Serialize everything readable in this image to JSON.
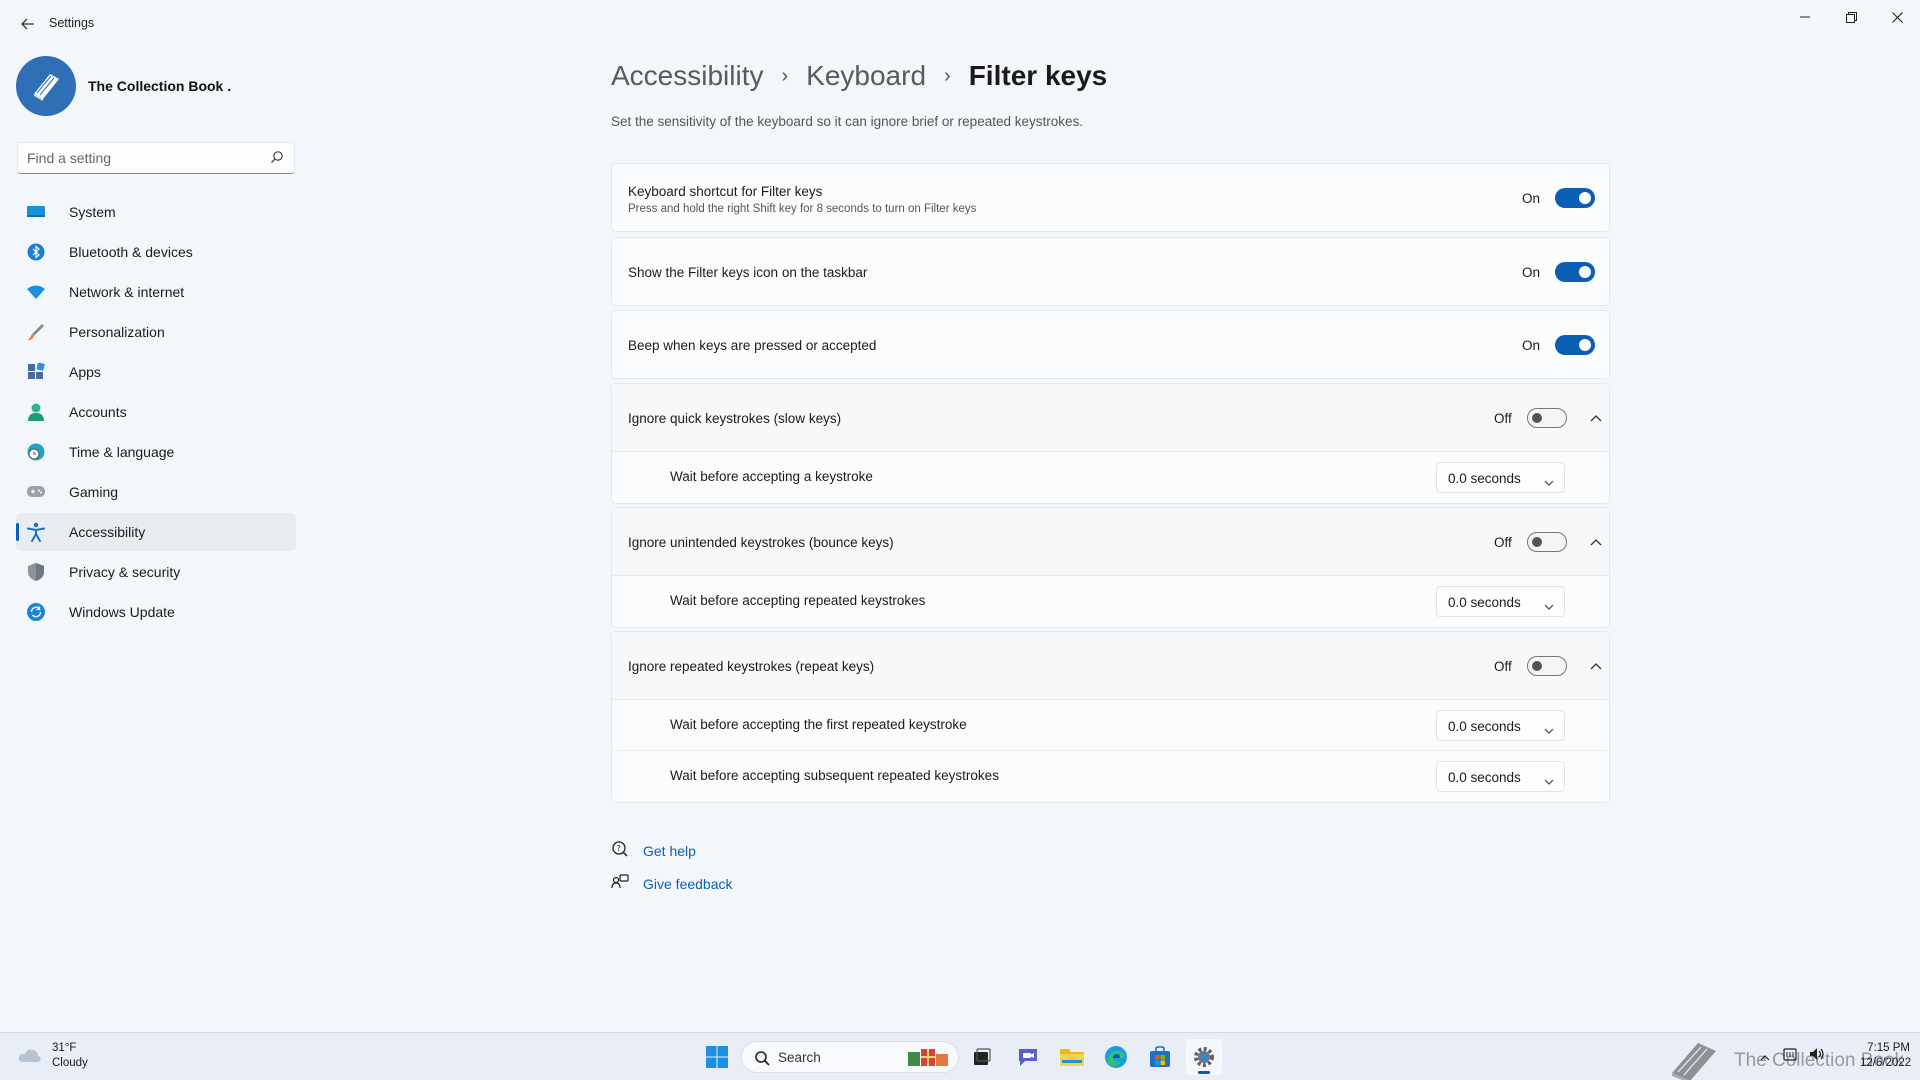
{
  "window": {
    "title": "Settings"
  },
  "profile": {
    "name": "The Collection Book ."
  },
  "search": {
    "placeholder": "Find a setting"
  },
  "sidebar": {
    "items": [
      {
        "label": "System",
        "icon": "monitor-icon"
      },
      {
        "label": "Bluetooth & devices",
        "icon": "bluetooth-icon"
      },
      {
        "label": "Network & internet",
        "icon": "wifi-icon"
      },
      {
        "label": "Personalization",
        "icon": "brush-icon"
      },
      {
        "label": "Apps",
        "icon": "apps-icon"
      },
      {
        "label": "Accounts",
        "icon": "person-icon"
      },
      {
        "label": "Time & language",
        "icon": "globe-clock-icon"
      },
      {
        "label": "Gaming",
        "icon": "gamepad-icon"
      },
      {
        "label": "Accessibility",
        "icon": "accessibility-icon",
        "selected": true
      },
      {
        "label": "Privacy & security",
        "icon": "shield-icon"
      },
      {
        "label": "Windows Update",
        "icon": "update-icon"
      }
    ]
  },
  "breadcrumb": {
    "items": [
      "Accessibility",
      "Keyboard",
      "Filter keys"
    ]
  },
  "page": {
    "description": "Set the sensitivity of the keyboard so it can ignore brief or repeated keystrokes."
  },
  "settings": {
    "shortcut": {
      "title": "Keyboard shortcut for Filter keys",
      "subtitle": "Press and hold the right Shift key for 8 seconds to turn on Filter keys",
      "state": "On"
    },
    "taskbar_icon": {
      "title": "Show the Filter keys icon on the taskbar",
      "state": "On"
    },
    "beep": {
      "title": "Beep when keys are pressed or accepted",
      "state": "On"
    },
    "slow_keys": {
      "title": "Ignore quick keystrokes (slow keys)",
      "state": "Off",
      "sub": [
        {
          "label": "Wait before accepting a keystroke",
          "value": "0.0 seconds"
        }
      ]
    },
    "bounce_keys": {
      "title": "Ignore unintended keystrokes (bounce keys)",
      "state": "Off",
      "sub": [
        {
          "label": "Wait before accepting repeated keystrokes",
          "value": "0.0 seconds"
        }
      ]
    },
    "repeat_keys": {
      "title": "Ignore repeated keystrokes (repeat keys)",
      "state": "Off",
      "sub": [
        {
          "label": "Wait before accepting the first repeated keystroke",
          "value": "0.0 seconds"
        },
        {
          "label": "Wait before accepting subsequent repeated keystrokes",
          "value": "0.0 seconds"
        }
      ]
    }
  },
  "links": {
    "help": "Get help",
    "feedback": "Give feedback"
  },
  "taskbar": {
    "weather": {
      "temp": "31°F",
      "condition": "Cloudy"
    },
    "search_label": "Search",
    "time": "7:15 PM",
    "date": "12/6/2022",
    "watermark": "The Collection Book"
  },
  "colors": {
    "accent": "#0a5fb4",
    "background": "#f3f6fb",
    "card": "#fbfcfe"
  }
}
